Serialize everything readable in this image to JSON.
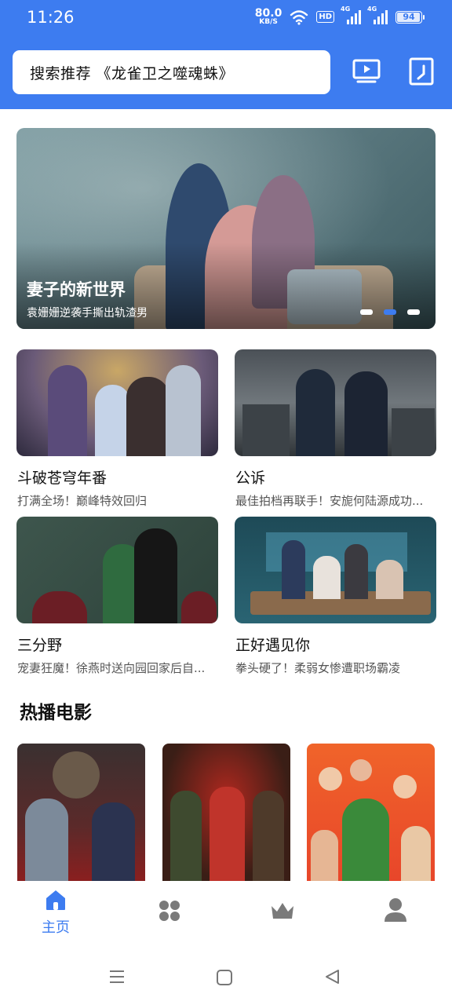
{
  "status_bar": {
    "time": "11:26",
    "net_speed": "80.0",
    "net_unit": "KB/S",
    "hd_label": "HD",
    "signal_1_label": "4G",
    "signal_2_label": "4G",
    "battery": "94"
  },
  "search": {
    "text": "搜索推荐 《龙雀卫之噬魂蛛》"
  },
  "header_icons": [
    "tv-icon",
    "phone-icon"
  ],
  "banner": {
    "title": "妻子的新世界",
    "subtitle": "袁姗姗逆袭手撕出轨渣男",
    "dots": 3,
    "active_dot": 2
  },
  "cards": [
    {
      "title": "斗破苍穹年番",
      "subtitle": "打满全场！巅峰特效回归"
    },
    {
      "title": "公诉",
      "subtitle": "最佳拍档再联手！安旎何陆源成功..."
    },
    {
      "title": "三分野",
      "subtitle": "宠妻狂魔！徐燕时送向园回家后自..."
    },
    {
      "title": "正好遇见你",
      "subtitle": "拳头硬了！柔弱女惨遭职场霸凌"
    }
  ],
  "section": {
    "title": "热播电影"
  },
  "nav": {
    "home_label": "主页",
    "accent": "#3d7cf0",
    "items": [
      "home-icon",
      "apps-icon",
      "crown-icon",
      "user-icon"
    ]
  },
  "colors": {
    "header_bg": "#3d7cf0",
    "icon_gray": "#7a7a7a"
  }
}
